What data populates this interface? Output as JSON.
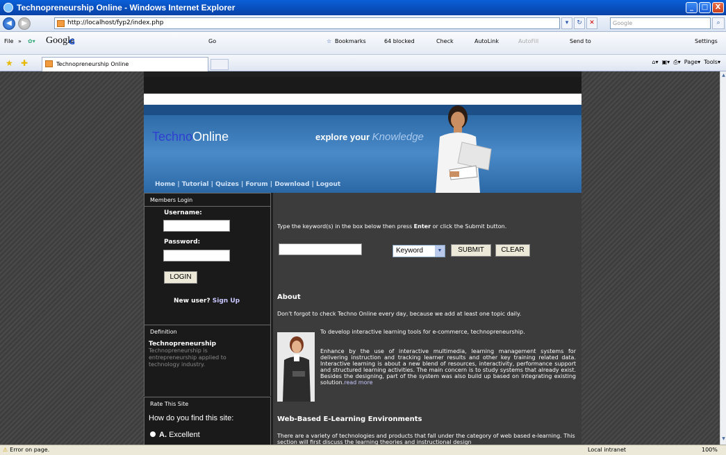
{
  "window": {
    "title": "Technopreneurship Online - Windows Internet Explorer",
    "min": "_",
    "max": "□",
    "close": "X"
  },
  "address": {
    "url": "http://localhost/fyp2/index.php",
    "search_placeholder": "Google"
  },
  "google_toolbar": {
    "file_menu": "File",
    "logo": "Google",
    "search_label": "G",
    "go": "Go",
    "bookmarks": "Bookmarks",
    "blocked": "64 blocked",
    "check": "Check",
    "autolink": "AutoLink",
    "autofill": "AutoFill",
    "send_to": "Send to",
    "settings": "Settings"
  },
  "tabs": {
    "active_label": "Technopreneurship Online",
    "commands": {
      "page": "Page",
      "tools": "Tools"
    }
  },
  "page": {
    "logo_techno": "Techno",
    "logo_online": "Online",
    "slogan": "explore your",
    "slogan_em": "Knowledge",
    "nav": [
      "Home",
      "Tutorial",
      "Quizes",
      "Forum",
      "Download",
      "Logout"
    ],
    "members_login": "Members Login",
    "username_label": "Username:",
    "password_label": "Password:",
    "login_button": "LOGIN",
    "new_user": "New user?",
    "sign_up": "Sign Up",
    "definition_head": "Definition",
    "definition_title": "Technopreneurship",
    "definition_text": "Technopreneurship is entrepreneurship applied to technology industry.",
    "rate_head": "Rate This Site",
    "rate_question": "How do you find this site:",
    "rate_option_a_letter": "A.",
    "rate_option_a": "Excellent",
    "search_intro_pre": "Type the keyword(s) in the box below then press",
    "search_intro_enter": "Enter",
    "search_intro_post": "or click the Submit button.",
    "search_select": "Keyword",
    "submit_button": "SUBMIT",
    "clear_button": "CLEAR",
    "about_heading": "About",
    "about_text": "Don't forgot to check Techno Online every day, because we add at least one topic daily.",
    "develop_text": "To develop interactive learning tools for e-commerce, technopreneurship.",
    "para_text": "Enhance by the use of interactive multimedia, learning management systems for delivering instruction and tracking learner results and other key training related data. Interactive learning is about a new blend of resources, interactivity, performance support and structured learning activities. The main concern is to study systems that already exist. Besides the designing, part of the system was also build up based on integrating existing solution.",
    "read_more": "read more",
    "wb_heading": "Web-Based E-Learning Environments",
    "wb_text": "There are a variety of technologies and products that fall under the category of web based e-learning. This section will first discuss the learning theories and instructional design"
  },
  "status": {
    "error": "Error on page.",
    "zone": "Local intranet",
    "zoom": "100%"
  },
  "colors": {
    "banner": "#2d6aa8",
    "page_bg": "#1f1f1f",
    "main_bg": "#3c3c3c"
  }
}
